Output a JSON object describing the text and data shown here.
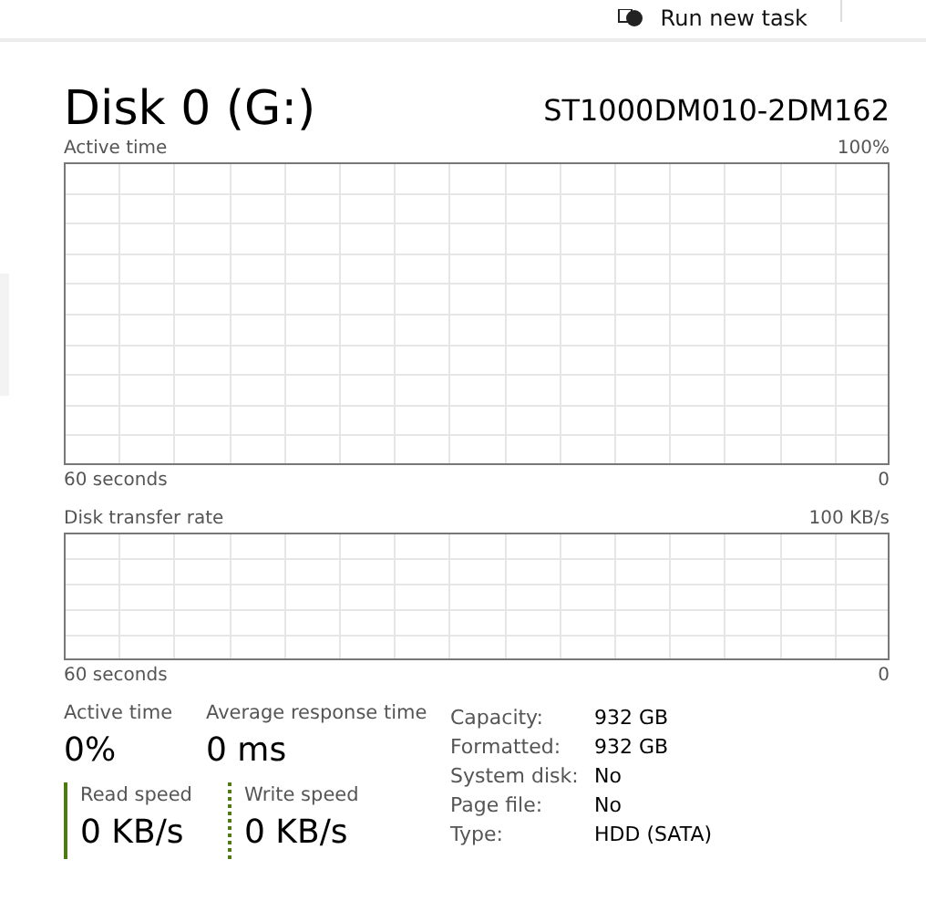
{
  "toolbar": {
    "button": "Run new task"
  },
  "header": {
    "title": "Disk 0 (G:)",
    "model": "ST1000DM010-2DM162"
  },
  "charts": [
    {
      "label": "Active time",
      "max": "100%",
      "duration": "60 seconds",
      "min": "0",
      "kind": "tall"
    },
    {
      "label": "Disk transfer rate",
      "max": "100 KB/s",
      "duration": "60 seconds",
      "min": "0",
      "kind": "short"
    }
  ],
  "stats": [
    {
      "label": "Active time",
      "value": "0%"
    },
    {
      "label": "Average response time",
      "value": "0 ms"
    }
  ],
  "speeds": [
    {
      "label": "Read speed",
      "value": "0 KB/s",
      "kind": "solid"
    },
    {
      "label": "Write speed",
      "value": "0 KB/s",
      "kind": "dotted"
    }
  ],
  "properties": [
    {
      "label": "Capacity:",
      "value": "932 GB"
    },
    {
      "label": "Formatted:",
      "value": "932 GB"
    },
    {
      "label": "System disk:",
      "value": "No"
    },
    {
      "label": "Page file:",
      "value": "No"
    },
    {
      "label": "Type:",
      "value": "HDD (SATA)"
    }
  ]
}
